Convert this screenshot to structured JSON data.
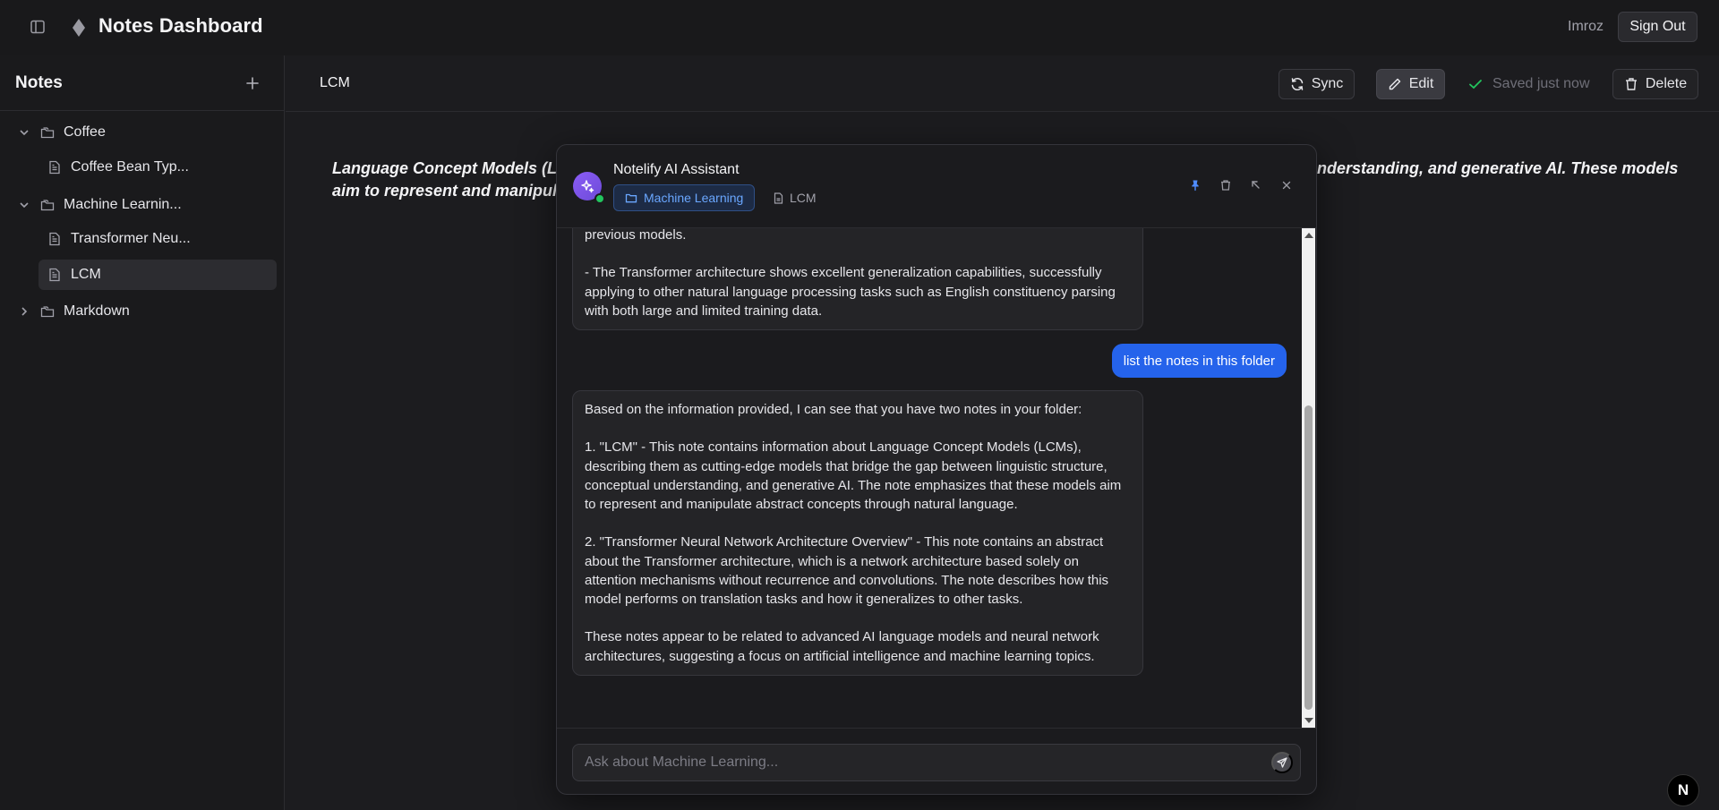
{
  "header": {
    "title": "Notes Dashboard",
    "username": "Imroz",
    "sign_out_label": "Sign Out"
  },
  "sidebar": {
    "title": "Notes",
    "tree": {
      "coffee_folder": "Coffee",
      "coffee_note": "Coffee Bean Typ...",
      "ml_folder": "Machine Learnin...",
      "transformer_note": "Transformer Neu...",
      "lcm_note": "LCM",
      "markdown_folder": "Markdown"
    }
  },
  "main": {
    "note_title": "LCM",
    "sync_label": "Sync",
    "edit_label": "Edit",
    "saved_status": "Saved just now",
    "delete_label": "Delete",
    "body_left_1": "Language Concept Models (LC",
    "body_left_2": "aim to represent and manipula",
    "body_right_1": "nderstanding, and generative AI. These models"
  },
  "assistant": {
    "title": "Notelify AI Assistant",
    "context_folder": "Machine Learning",
    "context_note": "LCM",
    "messages": {
      "ai_1_p1": "previous models.",
      "ai_1_p2": "- The Transformer architecture shows excellent generalization capabilities, successfully applying to other natural language processing tasks such as English constituency parsing with both large and limited training data.",
      "user_1": "list the notes in this folder",
      "ai_2_p1": "Based on the information provided, I can see that you have two notes in your folder:",
      "ai_2_p2": "1. \"LCM\" - This note contains information about Language Concept Models (LCMs), describing them as cutting-edge models that bridge the gap between linguistic structure, conceptual understanding, and generative AI. The note emphasizes that these models aim to represent and manipulate abstract concepts through natural language.",
      "ai_2_p3": "2. \"Transformer Neural Network Architecture Overview\" - This note contains an abstract about the Transformer architecture, which is a network architecture based solely on attention mechanisms without recurrence and convolutions. The note describes how this model performs on translation tasks and how it generalizes to other tasks.",
      "ai_2_p4": "These notes appear to be related to advanced AI language models and neural network architectures, suggesting a focus on artificial intelligence and machine learning topics."
    },
    "input_placeholder": "Ask about Machine Learning..."
  },
  "overlay": {
    "next_badge": "N"
  },
  "colors": {
    "accent_blue": "#2563eb",
    "online_green": "#22c55e",
    "avatar_purple": "#8b5cf6"
  },
  "icons": {
    "sidebar_toggle": "panel-left-icon",
    "brand": "diamond-logo-icon",
    "add": "plus-icon",
    "folder": "folder-icon",
    "file": "file-text-icon",
    "sync": "refresh-icon",
    "edit": "pencil-icon",
    "saved": "check-icon",
    "delete": "trash-icon",
    "ai": "sparkles-icon",
    "send": "send-icon"
  }
}
